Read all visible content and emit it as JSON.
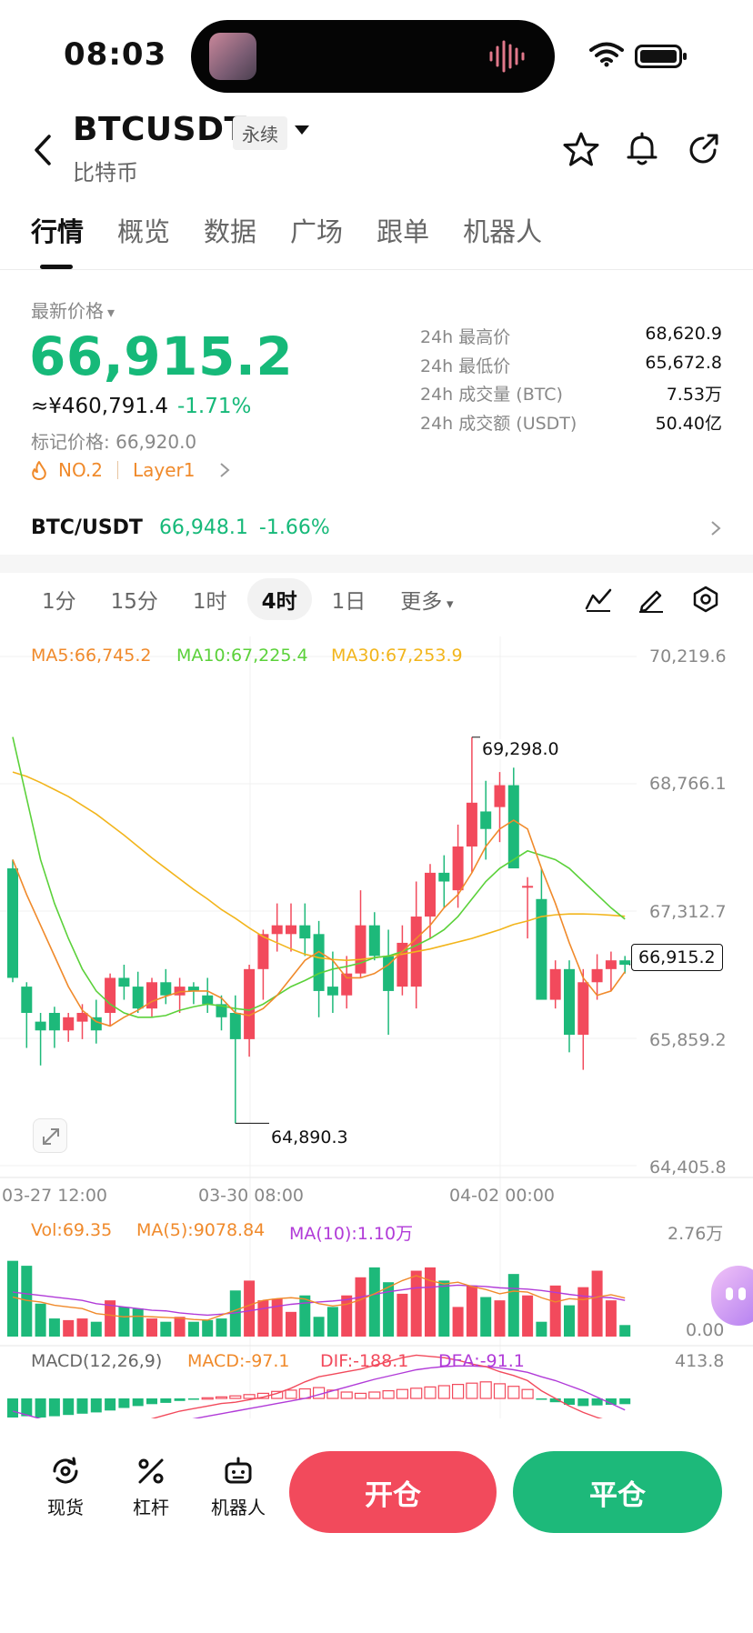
{
  "status": {
    "time": "08:03"
  },
  "header": {
    "symbol": "BTCUSDT",
    "contract_badge": "永续",
    "subname": "比特币"
  },
  "tabs": [
    {
      "label": "行情",
      "active": true
    },
    {
      "label": "概览"
    },
    {
      "label": "数据"
    },
    {
      "label": "广场"
    },
    {
      "label": "跟单"
    },
    {
      "label": "机器人"
    }
  ],
  "price": {
    "label": "最新价格",
    "last": "66,915.2",
    "cny": "≈¥460,791.4",
    "change_pct": "-1.71%",
    "mark_price": "标记价格: 66,920.0",
    "rank_tag": "NO.2",
    "category_tag": "Layer1"
  },
  "stats": [
    {
      "k": "24h 最高价",
      "v": "68,620.9"
    },
    {
      "k": "24h 最低价",
      "v": "65,672.8"
    },
    {
      "k": "24h 成交量 (BTC)",
      "v": "7.53万"
    },
    {
      "k": "24h 成交额 (USDT)",
      "v": "50.40亿"
    }
  ],
  "spot": {
    "pair": "BTC/USDT",
    "price": "66,948.1",
    "change": "-1.66%"
  },
  "intervals": [
    {
      "label": "1分"
    },
    {
      "label": "15分"
    },
    {
      "label": "1时"
    },
    {
      "label": "4时",
      "active": true
    },
    {
      "label": "1日"
    },
    {
      "label": "更多"
    }
  ],
  "colors": {
    "up": "#f24a5c",
    "down": "#1db97a",
    "ma5": "#f08a2b",
    "ma10": "#5bd13a",
    "ma30": "#f2b51c",
    "macd_dea": "#b13bd8"
  },
  "chart": {
    "ma_legend": {
      "ma5": "MA5:66,745.2",
      "ma10": "MA10:67,225.4",
      "ma30": "MA30:67,253.9"
    },
    "y_ticks": [
      "70,219.6",
      "68,766.1",
      "67,312.7",
      "65,859.2",
      "64,405.8"
    ],
    "time_ticks": [
      "03-27 12:00",
      "03-30 08:00",
      "04-02 00:00"
    ],
    "high_label": "69,298.0",
    "low_label": "64,890.3",
    "current_price": "66,915.2",
    "vol_legend": {
      "vol": "Vol:69.35",
      "ma5": "MA(5):9078.84",
      "ma10": "MA(10):1.10万"
    },
    "vol_ticks": [
      "2.76万",
      "0.00"
    ],
    "macd_legend": {
      "name": "MACD(12,26,9)",
      "macd": "MACD:-97.1",
      "dif": "DIF:-188.1",
      "dea": "DEA:-91.1"
    },
    "macd_tick": "413.8"
  },
  "chart_data": {
    "type": "candlestick",
    "interval": "4h",
    "ylim": [
      64405.8,
      70219.6
    ],
    "candles": [
      {
        "o": 67800,
        "h": 67900,
        "l": 66500,
        "c": 66550
      },
      {
        "o": 66450,
        "h": 66500,
        "l": 65750,
        "c": 66150
      },
      {
        "o": 66050,
        "h": 66150,
        "l": 65550,
        "c": 65950
      },
      {
        "o": 66150,
        "h": 66220,
        "l": 65750,
        "c": 65950
      },
      {
        "o": 65950,
        "h": 66150,
        "l": 65820,
        "c": 66100
      },
      {
        "o": 66050,
        "h": 66250,
        "l": 65850,
        "c": 66150
      },
      {
        "o": 66100,
        "h": 66300,
        "l": 65800,
        "c": 65950
      },
      {
        "o": 66150,
        "h": 66600,
        "l": 66000,
        "c": 66550
      },
      {
        "o": 66550,
        "h": 66700,
        "l": 66300,
        "c": 66450
      },
      {
        "o": 66450,
        "h": 66620,
        "l": 66150,
        "c": 66200
      },
      {
        "o": 66200,
        "h": 66550,
        "l": 66100,
        "c": 66500
      },
      {
        "o": 66500,
        "h": 66650,
        "l": 66250,
        "c": 66350
      },
      {
        "o": 66350,
        "h": 66550,
        "l": 66150,
        "c": 66450
      },
      {
        "o": 66450,
        "h": 66500,
        "l": 66250,
        "c": 66400
      },
      {
        "o": 66350,
        "h": 66550,
        "l": 66150,
        "c": 66250
      },
      {
        "o": 66250,
        "h": 66350,
        "l": 65950,
        "c": 66100
      },
      {
        "o": 66150,
        "h": 66350,
        "l": 64890,
        "c": 65850
      },
      {
        "o": 65850,
        "h": 66700,
        "l": 65650,
        "c": 66650
      },
      {
        "o": 66650,
        "h": 67100,
        "l": 66300,
        "c": 67050
      },
      {
        "o": 67050,
        "h": 67400,
        "l": 66850,
        "c": 67150
      },
      {
        "o": 67050,
        "h": 67400,
        "l": 66850,
        "c": 67150
      },
      {
        "o": 67150,
        "h": 67400,
        "l": 66800,
        "c": 67000
      },
      {
        "o": 67050,
        "h": 67200,
        "l": 66100,
        "c": 66400
      },
      {
        "o": 66450,
        "h": 66850,
        "l": 66150,
        "c": 66350
      },
      {
        "o": 66350,
        "h": 66800,
        "l": 66200,
        "c": 66600
      },
      {
        "o": 66600,
        "h": 67550,
        "l": 66550,
        "c": 67150
      },
      {
        "o": 67150,
        "h": 67300,
        "l": 66750,
        "c": 66800
      },
      {
        "o": 66800,
        "h": 67100,
        "l": 65900,
        "c": 66400
      },
      {
        "o": 66450,
        "h": 67150,
        "l": 66350,
        "c": 66950
      },
      {
        "o": 66450,
        "h": 67650,
        "l": 66200,
        "c": 67250
      },
      {
        "o": 67250,
        "h": 67850,
        "l": 67000,
        "c": 67750
      },
      {
        "o": 67750,
        "h": 67950,
        "l": 67350,
        "c": 67650
      },
      {
        "o": 67550,
        "h": 68300,
        "l": 67350,
        "c": 68050
      },
      {
        "o": 68050,
        "h": 69298,
        "l": 67750,
        "c": 68550
      },
      {
        "o": 68450,
        "h": 68800,
        "l": 67900,
        "c": 68250
      },
      {
        "o": 68500,
        "h": 68900,
        "l": 68100,
        "c": 68750
      },
      {
        "o": 68750,
        "h": 68950,
        "l": 67950,
        "c": 67800
      },
      {
        "o": 67600,
        "h": 67700,
        "l": 67000,
        "c": 67600
      },
      {
        "o": 67450,
        "h": 67800,
        "l": 66300,
        "c": 66300
      },
      {
        "o": 66300,
        "h": 66750,
        "l": 66200,
        "c": 66650
      },
      {
        "o": 66650,
        "h": 66750,
        "l": 65700,
        "c": 65900
      },
      {
        "o": 65900,
        "h": 66650,
        "l": 65500,
        "c": 66500
      },
      {
        "o": 66500,
        "h": 66820,
        "l": 66300,
        "c": 66650
      },
      {
        "o": 66650,
        "h": 66850,
        "l": 66400,
        "c": 66750
      },
      {
        "o": 66750,
        "h": 66800,
        "l": 66600,
        "c": 66700
      }
    ],
    "ma5": [
      67900,
      67500,
      67150,
      66800,
      66450,
      66180,
      66050,
      66000,
      66100,
      66180,
      66280,
      66340,
      66390,
      66400,
      66400,
      66320,
      66150,
      66120,
      66200,
      66350,
      66550,
      66750,
      66850,
      66750,
      66550,
      66550,
      66600,
      66700,
      66850,
      67000,
      67150,
      67350,
      67500,
      67750,
      68050,
      68250,
      68350,
      68250,
      67800,
      67400,
      66950,
      66550,
      66350,
      66400,
      66620
    ],
    "ma10": [
      69300,
      68600,
      67900,
      67400,
      67000,
      66650,
      66400,
      66250,
      66150,
      66100,
      66100,
      66120,
      66180,
      66220,
      66250,
      66230,
      66200,
      66180,
      66250,
      66350,
      66450,
      66520,
      66600,
      66650,
      66680,
      66720,
      66780,
      66800,
      66850,
      66920,
      67000,
      67100,
      67250,
      67450,
      67650,
      67800,
      67900,
      68000,
      67950,
      67900,
      67800,
      67650,
      67500,
      67350,
      67220
    ],
    "ma30": [
      68900,
      68850,
      68780,
      68700,
      68620,
      68520,
      68420,
      68300,
      68180,
      68050,
      67920,
      67800,
      67680,
      67560,
      67450,
      67330,
      67230,
      67120,
      67020,
      66950,
      66880,
      66820,
      66780,
      66760,
      66750,
      66760,
      66780,
      66800,
      66820,
      66850,
      66880,
      66920,
      66960,
      67000,
      67050,
      67100,
      67160,
      67200,
      67250,
      67270,
      67280,
      67280,
      67275,
      67265,
      67254
    ],
    "volume": {
      "ylim": [
        0,
        27600
      ],
      "values": [
        23000,
        21500,
        10000,
        5500,
        5000,
        5500,
        4500,
        11000,
        9000,
        8500,
        5500,
        4500,
        6000,
        4500,
        5000,
        5500,
        14000,
        17000,
        11000,
        11500,
        7500,
        12500,
        6000,
        9000,
        12500,
        18000,
        21000,
        16500,
        13000,
        20000,
        21000,
        17000,
        9000,
        15500,
        12000,
        11000,
        19000,
        12500,
        4500,
        15500,
        9500,
        15000,
        20000,
        11000,
        3500
      ],
      "ma5": [
        12000,
        11000,
        10500,
        9500,
        9000,
        8500,
        7000,
        6500,
        6000,
        6200,
        6000,
        5800,
        5600,
        5200,
        5000,
        6500,
        8000,
        9500,
        11000,
        11500,
        11800,
        11400,
        10000,
        9300,
        9800,
        11200,
        13000,
        15000,
        17000,
        18500,
        17000,
        16000,
        16500,
        15200,
        14300,
        13000,
        13800,
        13500,
        11800,
        10500,
        11500,
        11200,
        12000,
        12700,
        11700
      ],
      "ma10": [
        13500,
        13000,
        12500,
        12000,
        11500,
        11000,
        10000,
        9500,
        9000,
        8500,
        8000,
        7800,
        7200,
        6800,
        6500,
        6800,
        7200,
        7800,
        8500,
        9200,
        9800,
        10200,
        10500,
        10800,
        11200,
        12000,
        12800,
        13600,
        14200,
        14800,
        15000,
        15300,
        15600,
        15400,
        15200,
        14800,
        14600,
        14400,
        14000,
        13400,
        12800,
        12300,
        12000,
        11800,
        11000
      ]
    },
    "macd": {
      "histogram": [
        -150,
        -140,
        -150,
        -140,
        -130,
        -120,
        -110,
        -95,
        -75,
        -60,
        -45,
        -35,
        -20,
        -10,
        5,
        12,
        20,
        30,
        40,
        55,
        65,
        75,
        85,
        65,
        50,
        40,
        50,
        60,
        70,
        80,
        90,
        100,
        110,
        120,
        130,
        115,
        95,
        70,
        -10,
        -30,
        -50,
        -60,
        -55,
        -50,
        -45
      ],
      "dif": [
        -250,
        -280,
        -300,
        -310,
        -300,
        -290,
        -270,
        -250,
        -220,
        -190,
        -160,
        -130,
        -100,
        -80,
        -60,
        -40,
        -30,
        -10,
        10,
        40,
        80,
        130,
        170,
        190,
        210,
        230,
        260,
        290,
        320,
        340,
        330,
        320,
        300,
        270,
        250,
        210,
        180,
        140,
        60,
        0,
        -60,
        -110,
        -150,
        -180,
        -188
      ],
      "dea": [
        -100,
        -130,
        -160,
        -190,
        -210,
        -220,
        -230,
        -235,
        -230,
        -220,
        -210,
        -195,
        -180,
        -160,
        -140,
        -120,
        -100,
        -80,
        -60,
        -40,
        -20,
        0,
        30,
        60,
        90,
        120,
        150,
        175,
        200,
        225,
        240,
        250,
        255,
        255,
        250,
        240,
        225,
        205,
        170,
        140,
        100,
        60,
        10,
        -40,
        -91
      ]
    }
  },
  "bottom": {
    "spot_label": "现货",
    "margin_label": "杠杆",
    "bot_label": "机器人",
    "open_label": "开仓",
    "close_label": "平仓"
  }
}
